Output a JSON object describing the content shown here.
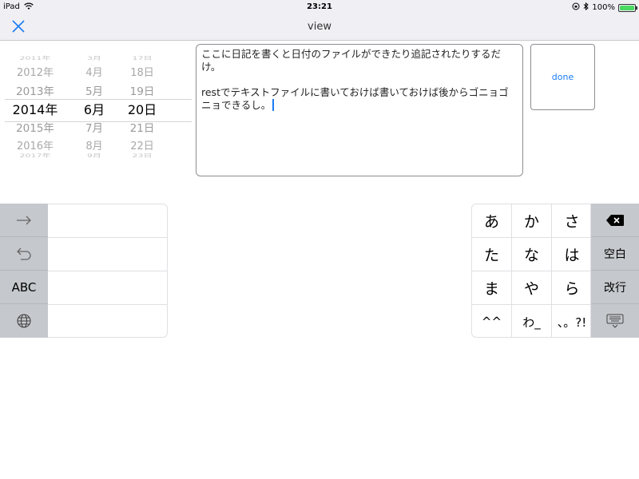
{
  "status": {
    "device": "iPad",
    "time": "23:21",
    "battery": "100%",
    "battery_level": 1.0
  },
  "nav": {
    "title": "view"
  },
  "picker": {
    "rows": [
      {
        "year": "2011年",
        "month": "3月",
        "day": "17日"
      },
      {
        "year": "2012年",
        "month": "4月",
        "day": "18日"
      },
      {
        "year": "2013年",
        "month": "5月",
        "day": "19日"
      },
      {
        "year": "2014年",
        "month": "6月",
        "day": "20日"
      },
      {
        "year": "2015年",
        "month": "7月",
        "day": "21日"
      },
      {
        "year": "2016年",
        "month": "8月",
        "day": "22日"
      },
      {
        "year": "2017年",
        "month": "9月",
        "day": "23日"
      }
    ],
    "selected_index": 3
  },
  "note": {
    "line1": "ここに日記を書くと日付のファイルができたり追記されたりするだけ。",
    "line2": "restでテキストファイルに書いておけば書いておけば後からゴニョゴニョできるし。"
  },
  "done_label": "done",
  "keyboard": {
    "left_abc": "ABC",
    "kana": [
      "あ",
      "か",
      "さ",
      "た",
      "な",
      "は",
      "ま",
      "や",
      "ら",
      "^^",
      "わ_",
      "、。?!"
    ],
    "space_label": "空白",
    "return_label": "改行"
  },
  "colors": {
    "accent": "#1b7cf5",
    "bar_bg": "#efeff4",
    "key_dark": "#c5c8cc"
  }
}
